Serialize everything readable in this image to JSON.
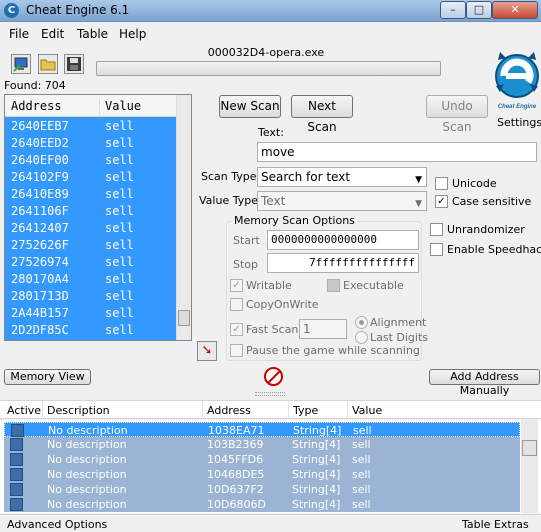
{
  "window": {
    "title": "Cheat Engine 6.1",
    "minimize": "–",
    "maximize": "□",
    "close": "✕"
  },
  "menu": [
    "File",
    "Edit",
    "Table",
    "Help"
  ],
  "process": {
    "title": "000032D4-opera.exe"
  },
  "found": "Found: 704",
  "results": {
    "columns": [
      "Address",
      "Value"
    ],
    "rows": [
      {
        "address": "2640EEB7",
        "value": "sell"
      },
      {
        "address": "2640EED2",
        "value": "sell"
      },
      {
        "address": "2640EF00",
        "value": "sell"
      },
      {
        "address": "264102F9",
        "value": "sell"
      },
      {
        "address": "26410E89",
        "value": "sell"
      },
      {
        "address": "2641106F",
        "value": "sell"
      },
      {
        "address": "26412407",
        "value": "sell"
      },
      {
        "address": "2752626F",
        "value": "sell"
      },
      {
        "address": "27526974",
        "value": "sell"
      },
      {
        "address": "280170A4",
        "value": "sell"
      },
      {
        "address": "2801713D",
        "value": "sell"
      },
      {
        "address": "2A44B157",
        "value": "sell"
      },
      {
        "address": "2D2DF85C",
        "value": "sell"
      }
    ]
  },
  "buttons": {
    "new_scan": "New Scan",
    "next_scan": "Next Scan",
    "undo_scan": "Undo Scan",
    "settings": "Settings",
    "memory_view": "Memory View",
    "add_address": "Add Address Manually"
  },
  "logo_text": "Cheat Engine",
  "scan": {
    "text_label": "Text:",
    "text_value": "move",
    "scan_type_label": "Scan Type",
    "scan_type_value": "Search for text",
    "value_type_label": "Value Type",
    "value_type_value": "Text"
  },
  "options": {
    "unicode": "Unicode",
    "case_sensitive": "Case sensitive",
    "unrandomizer": "Unrandomizer",
    "speedhack": "Enable Speedhack"
  },
  "memory_scan": {
    "title": "Memory Scan Options",
    "start_label": "Start",
    "start_value": "0000000000000000",
    "stop_label": "Stop",
    "stop_value": "7fffffffffffffff",
    "writable": "Writable",
    "executable": "Executable",
    "copy_on_write": "CopyOnWrite",
    "fast_scan": "Fast Scan",
    "fast_scan_value": "1",
    "alignment": "Alignment",
    "last_digits": "Last Digits",
    "pause": "Pause the game while scanning"
  },
  "address_table": {
    "columns": [
      "Active",
      "Description",
      "Address",
      "Type",
      "Value"
    ],
    "rows": [
      {
        "description": "No description",
        "address": "1038EA71",
        "type": "String[4]",
        "value": "sell"
      },
      {
        "description": "No description",
        "address": "103B2369",
        "type": "String[4]",
        "value": "sell"
      },
      {
        "description": "No description",
        "address": "1045FFD6",
        "type": "String[4]",
        "value": "sell"
      },
      {
        "description": "No description",
        "address": "10468DE5",
        "type": "String[4]",
        "value": "sell"
      },
      {
        "description": "No description",
        "address": "10D637F2",
        "type": "String[4]",
        "value": "sell"
      },
      {
        "description": "No description",
        "address": "10D6806D",
        "type": "String[4]",
        "value": "sell"
      }
    ]
  },
  "status": {
    "left": "Advanced Options",
    "right": "Table Extras"
  },
  "colors": {
    "selection": "#3399ff",
    "table_row": "#9bb4d4",
    "logo": "#1b8fd0"
  }
}
